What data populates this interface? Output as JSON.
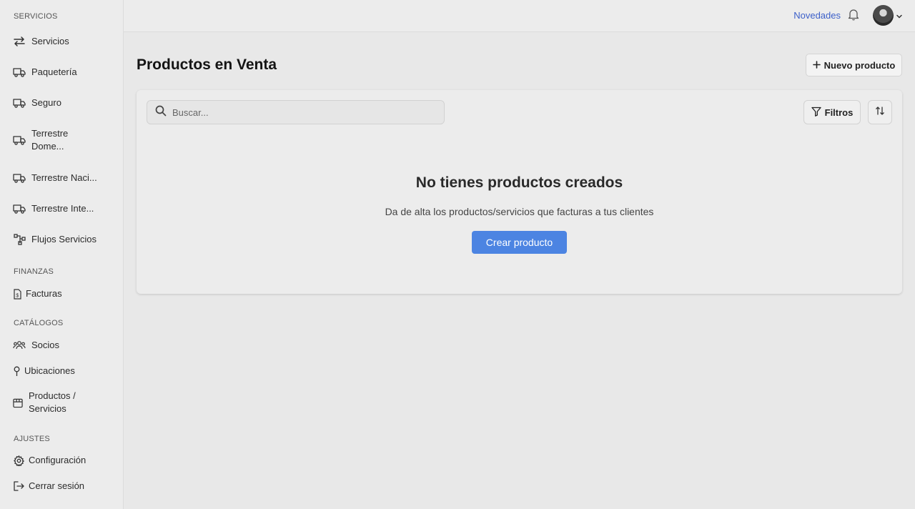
{
  "sidebar": {
    "sections": {
      "servicios": "SERVICIOS",
      "finanzas": "FINANZAS",
      "catalogos": "CATÁLOGOS",
      "ajustes": "AJUSTES"
    },
    "items": [
      {
        "label": "Servicios",
        "icon": "arrows-exchange-icon"
      },
      {
        "label": "Paquetería",
        "icon": "truck-icon"
      },
      {
        "label": "Seguro",
        "icon": "truck-icon"
      },
      {
        "label": "Terrestre Dome...",
        "icon": "truck-icon"
      },
      {
        "label": "Terrestre Naci...",
        "icon": "truck-icon"
      },
      {
        "label": "Terrestre Inte...",
        "icon": "truck-icon"
      },
      {
        "label": "Flujos Servicios",
        "icon": "flow-icon"
      },
      {
        "label": "Facturas",
        "icon": "invoice-icon"
      },
      {
        "label": "Socios",
        "icon": "users-icon"
      },
      {
        "label": "Ubicaciones",
        "icon": "pin-icon"
      },
      {
        "label": "Productos / Servicios",
        "icon": "box-icon"
      },
      {
        "label": "Configuración",
        "icon": "gear-icon"
      },
      {
        "label": "Cerrar sesión",
        "icon": "logout-icon"
      }
    ]
  },
  "topbar": {
    "novedades": "Novedades"
  },
  "main": {
    "title": "Productos en Venta",
    "new_button": "Nuevo producto",
    "search_placeholder": "Buscar...",
    "filter_button": "Filtros",
    "empty_title": "No tienes productos creados",
    "empty_subtitle": "Da de alta los productos/servicios que facturas a tus clientes",
    "create_button": "Crear producto"
  },
  "colors": {
    "accent": "#4c84e2",
    "link": "#3b5fc9"
  }
}
